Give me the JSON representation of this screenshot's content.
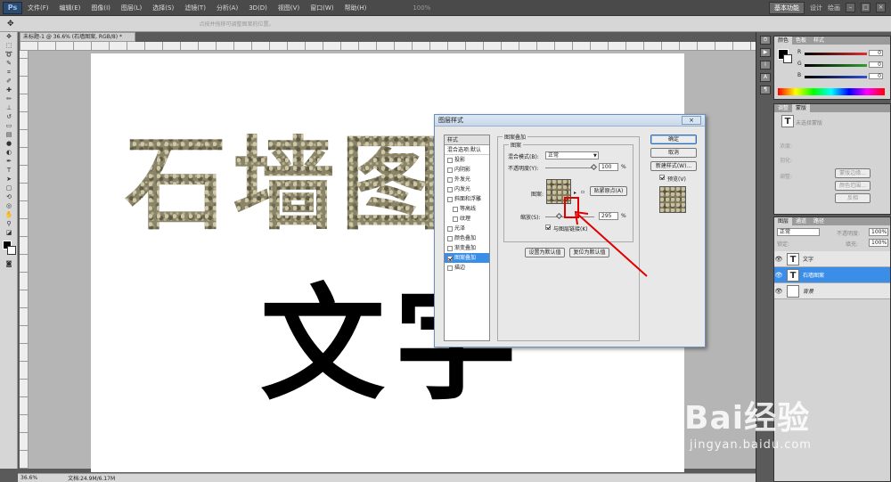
{
  "menubar": {
    "logo": "Ps",
    "items": [
      "文件(F)",
      "编辑(E)",
      "图像(I)",
      "图层(L)",
      "选择(S)",
      "滤镜(T)",
      "分析(A)",
      "3D(D)",
      "视图(V)",
      "窗口(W)",
      "帮助(H)"
    ],
    "zoom": "100%",
    "workspace_active": "基本功能",
    "workspace_other": [
      "设计",
      "绘画"
    ],
    "window_buttons": [
      "–",
      "□",
      "×"
    ]
  },
  "optbar": {
    "hint": "点按并拖移可调整图案的位置。"
  },
  "document": {
    "tab_title": "未标题-1 @ 36.6% (石墙图案, RGB/8) *",
    "text_line1": "石墙图",
    "text_line2": "文字"
  },
  "status": {
    "zoom": "36.6%",
    "doc": "文档:24.9M/6.17M"
  },
  "color_panel": {
    "tabs": [
      "颜色",
      "色板",
      "样式"
    ],
    "channels": [
      {
        "name": "R",
        "value": "0"
      },
      {
        "name": "G",
        "value": "0"
      },
      {
        "name": "B",
        "value": "0"
      }
    ],
    "accent_colors": {
      "R": "#e03030",
      "G": "#30a030",
      "B": "#3050d0"
    }
  },
  "adjust_panel": {
    "tabs": [
      "调整",
      "蒙版"
    ],
    "mask_label": "未选择蒙版",
    "fields": [
      "浓度:",
      "羽化:",
      "调整:"
    ],
    "buttons": [
      "蒙版边缘...",
      "颜色范围...",
      "反相"
    ]
  },
  "layers_panel": {
    "tabs": [
      "图层",
      "通道",
      "路径"
    ],
    "blend_mode": "正常",
    "opacity_label": "不透明度:",
    "opacity": "100%",
    "lock_label": "锁定:",
    "fill_label": "填充:",
    "fill": "100%",
    "layers": [
      {
        "name": "文字",
        "thumb": "T",
        "selected": false
      },
      {
        "name": "石墙图案",
        "thumb": "T",
        "selected": true
      },
      {
        "name": "背景",
        "thumb": "",
        "selected": false
      }
    ]
  },
  "dialog": {
    "title": "图层样式",
    "close": "×",
    "styles_header": "样式",
    "blend_options": "混合选项:默认",
    "items": [
      {
        "label": "投影",
        "checked": false,
        "indent": false
      },
      {
        "label": "内阴影",
        "checked": false,
        "indent": false
      },
      {
        "label": "外发光",
        "checked": false,
        "indent": false
      },
      {
        "label": "内发光",
        "checked": false,
        "indent": false
      },
      {
        "label": "斜面和浮雕",
        "checked": false,
        "indent": false
      },
      {
        "label": "等高线",
        "checked": false,
        "indent": true
      },
      {
        "label": "纹理",
        "checked": false,
        "indent": true
      },
      {
        "label": "光泽",
        "checked": false,
        "indent": false
      },
      {
        "label": "颜色叠加",
        "checked": false,
        "indent": false
      },
      {
        "label": "渐变叠加",
        "checked": false,
        "indent": false
      },
      {
        "label": "图案叠加",
        "checked": true,
        "indent": false,
        "selected": true
      },
      {
        "label": "描边",
        "checked": false,
        "indent": false
      }
    ],
    "group_outer": "图案叠加",
    "group_inner": "图案",
    "blend_label": "混合模式(B):",
    "blend_value": "正常",
    "opacity_label": "不透明度(Y):",
    "opacity_value": "100",
    "opacity_pct": 1.0,
    "pattern_label": "图案:",
    "snap_btn": "贴紧原点(A)",
    "scale_label": "缩放(S):",
    "scale_value": "295",
    "scale_pct": 0.295,
    "percent": "%",
    "link_label": "与图层链接(K)",
    "default_btn": "设置为默认值",
    "reset_btn": "复位为默认值",
    "ok": "确定",
    "cancel": "取消",
    "new_style": "新建样式(W)...",
    "preview": "预览(V)"
  },
  "watermark": {
    "brand": "Bai经验",
    "url": "jingyan.baidu.com"
  }
}
